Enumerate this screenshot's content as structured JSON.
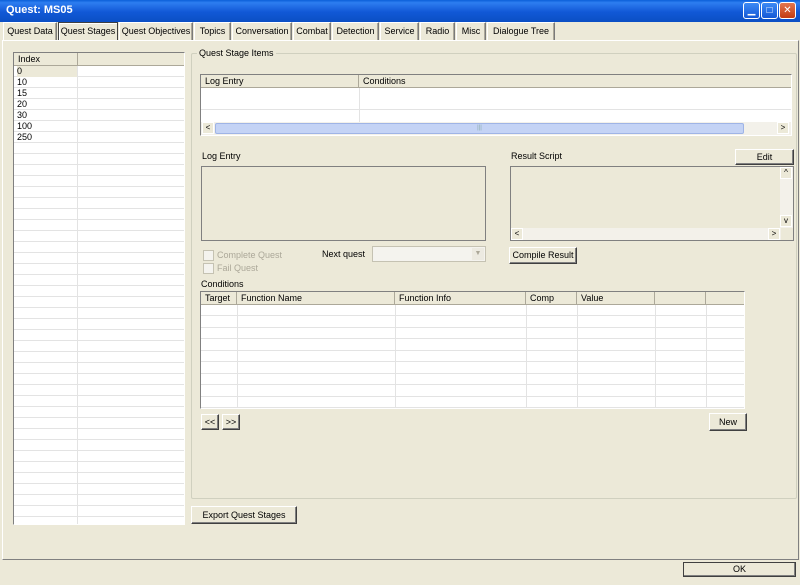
{
  "window": {
    "title": "Quest: MS05"
  },
  "tabs": [
    {
      "label": "Quest Data"
    },
    {
      "label": "Quest Stages"
    },
    {
      "label": "Quest Objectives"
    },
    {
      "label": "Topics"
    },
    {
      "label": "Conversation"
    },
    {
      "label": "Combat"
    },
    {
      "label": "Detection"
    },
    {
      "label": "Service"
    },
    {
      "label": "Radio"
    },
    {
      "label": "Misc"
    },
    {
      "label": "Dialogue Tree"
    }
  ],
  "index_list": {
    "header": "Index",
    "items": [
      "0",
      "10",
      "15",
      "20",
      "30",
      "100",
      "250"
    ]
  },
  "quest_stage_items": {
    "group_label": "Quest Stage Items",
    "columns": [
      "Log Entry",
      "Conditions"
    ]
  },
  "log_entry": {
    "label": "Log Entry",
    "value": ""
  },
  "result_script": {
    "label": "Result Script",
    "edit_label": "Edit",
    "value": ""
  },
  "complete_quest": {
    "label": "Complete Quest",
    "checked": false
  },
  "fail_quest": {
    "label": "Fail Quest",
    "checked": false
  },
  "next_quest": {
    "label": "Next quest",
    "value": ""
  },
  "compile_result": {
    "label": "Compile Result"
  },
  "conditions": {
    "label": "Conditions",
    "columns": [
      "Target",
      "Function Name",
      "Function Info",
      "Comp",
      "Value",
      "",
      ""
    ]
  },
  "nav": {
    "prev_label": "<<",
    "next_label": ">>"
  },
  "new_button": {
    "label": "New"
  },
  "export_button": {
    "label": "Export Quest Stages"
  },
  "ok_button": {
    "label": "OK"
  },
  "colors": {
    "titlebar": "#0b4fc4",
    "face": "#ece9d8",
    "selection": "#c4d3f5"
  }
}
